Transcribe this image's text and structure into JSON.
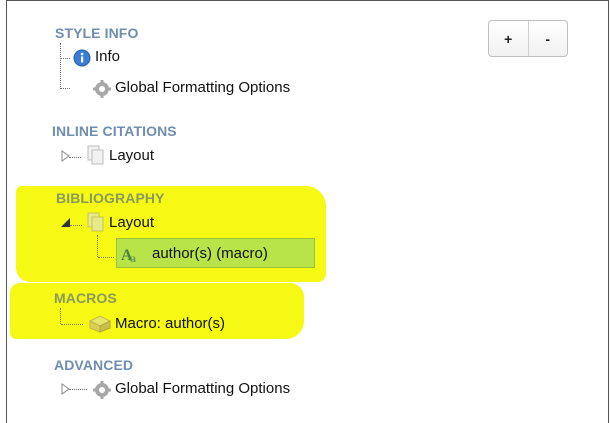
{
  "sections": {
    "style_info": {
      "title": "STYLE INFO",
      "items": [
        "Info",
        "Global Formatting Options"
      ]
    },
    "inline_citations": {
      "title": "INLINE CITATIONS",
      "items": [
        "Layout"
      ]
    },
    "bibliography": {
      "title": "BIBLIOGRAPHY",
      "items": [
        "Layout",
        "author(s) (macro)"
      ]
    },
    "macros": {
      "title": "MACROS",
      "items": [
        "Macro: author(s)"
      ]
    },
    "advanced": {
      "title": "ADVANCED",
      "items": [
        "Global Formatting Options"
      ]
    }
  },
  "zoom": {
    "plus": "+",
    "minus": "-"
  },
  "colors": {
    "section_title": "#6f8db0",
    "highlight": "#f5f900",
    "selected": "#b8e44a"
  }
}
